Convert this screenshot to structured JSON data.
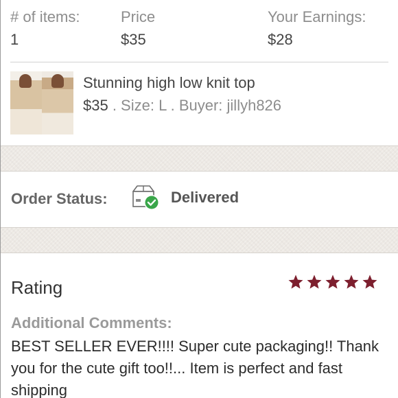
{
  "summary": {
    "items_label": "# of items:",
    "items_value": "1",
    "price_label": "Price",
    "price_value": "$35",
    "earnings_label": "Your Earnings:",
    "earnings_value": "$28"
  },
  "item": {
    "title": "Stunning high low knit top",
    "price": "$35",
    "details": " . Size: L . Buyer: jillyh826"
  },
  "order": {
    "status_label": "Order Status:",
    "status_value": "Delivered",
    "status_icon": "package-delivered-icon",
    "status_color": "#3aa64a"
  },
  "rating": {
    "title": "Rating",
    "stars": 5,
    "star_color": "#7d1f2e",
    "comments_label": "Additional Comments:",
    "comments_text": "BEST SELLER EVER!!!! Super cute packaging!! Thank you for the cute gift too!!... Item is perfect and fast shipping"
  }
}
